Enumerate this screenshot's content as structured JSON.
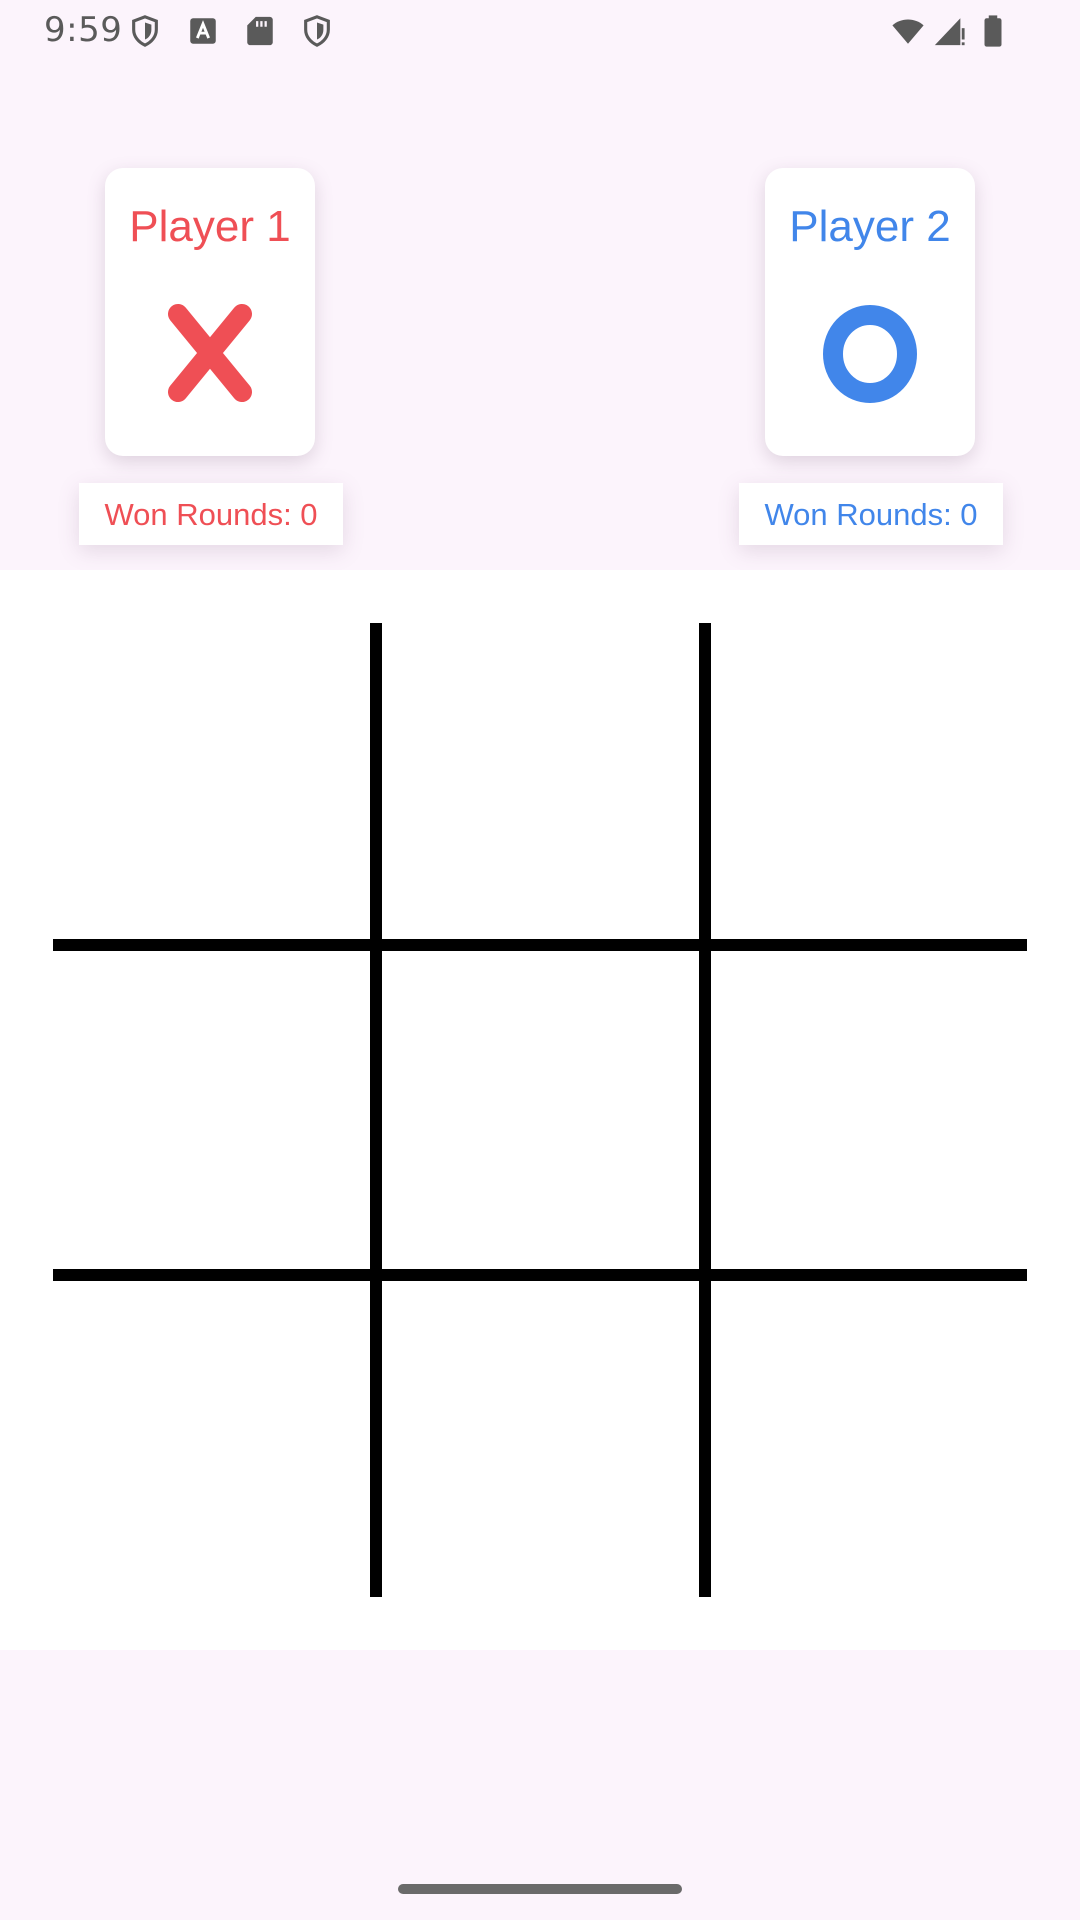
{
  "status_bar": {
    "time": "9:59",
    "left_icons": [
      "shield-icon",
      "text-a-icon",
      "sd-card-icon",
      "shield-icon"
    ],
    "right_icons": [
      "wifi-icon",
      "cell-signal-icon",
      "battery-icon"
    ]
  },
  "players": [
    {
      "name": "Player 1",
      "symbol": "X",
      "won_rounds_label": "Won Rounds: 0",
      "color": "#ef4f55"
    },
    {
      "name": "Player 2",
      "symbol": "O",
      "won_rounds_label": "Won Rounds: 0",
      "color": "#4186ea"
    }
  ],
  "board": {
    "rows": 3,
    "cols": 3,
    "cells": [
      "",
      "",
      "",
      "",
      "",
      "",
      "",
      "",
      ""
    ],
    "line_color": "#000000"
  },
  "colors": {
    "background": "#fcf4fc",
    "board_background": "#ffffff"
  }
}
